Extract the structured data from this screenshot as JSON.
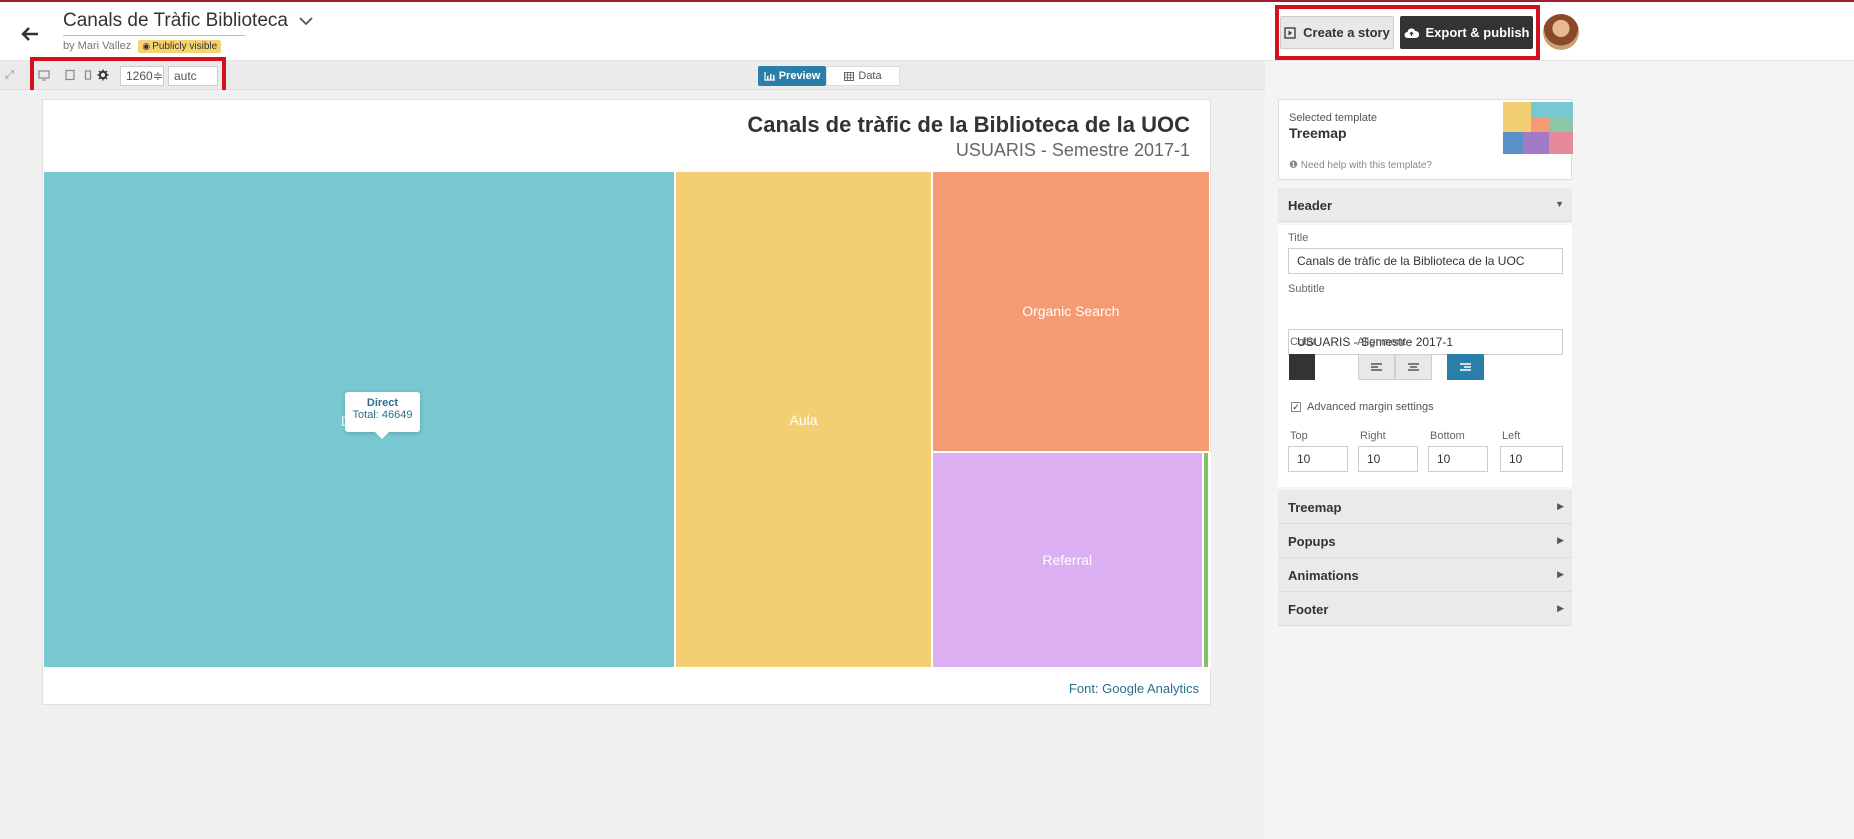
{
  "header": {
    "doc_title": "Canals de Tràfic Biblioteca",
    "byline": "by Mari Vallez",
    "visibility_badge": "Publicly visible",
    "create_story_label": "Create a story",
    "export_label": "Export & publish"
  },
  "toolbar": {
    "width_value": "1260",
    "height_value": "autc",
    "preview_label": "Preview",
    "data_label": "Data"
  },
  "chart": {
    "title": "Canals de tràfic de la Biblioteca de la UOC",
    "subtitle": "USUARIS - Semestre 2017-1",
    "footer": "Font: Google Analytics",
    "tooltip_name": "Direct",
    "tooltip_value": "Total: 46649"
  },
  "chart_data": {
    "type": "treemap",
    "title": "Canals de tràfic de la Biblioteca de la UOC",
    "subtitle": "USUARIS - Semestre 2017-1",
    "nodes": [
      {
        "name": "Direct",
        "value": 46649,
        "color": "#77c8d0"
      },
      {
        "name": "Aula",
        "value": 18900,
        "color": "#f4ce73"
      },
      {
        "name": "Organic Search",
        "value": 11600,
        "color": "#f59b74"
      },
      {
        "name": "Referral",
        "value": 8700,
        "color": "#dcaef2"
      },
      {
        "name": "",
        "value": 210,
        "color": "#7cc466"
      },
      {
        "name": "",
        "value": 20,
        "color": "#77c8d0"
      }
    ]
  },
  "panel": {
    "selected_template_label": "Selected template",
    "template_name": "Treemap",
    "help_text": "Need help with this template?",
    "sections": {
      "header": "Header",
      "treemap": "Treemap",
      "popups": "Popups",
      "animations": "Animations",
      "footer": "Footer"
    },
    "title_label": "Title",
    "title_value": "Canals de tràfic de la Biblioteca de la UOC",
    "subtitle_label": "Subtitle",
    "subtitle_value": "USUARIS - Semestre 2017-1",
    "color_label": "Color",
    "alignment_label": "Alignment",
    "alignment_selected": "right",
    "advanced_margin_label": "Advanced margin settings",
    "margins": {
      "top_label": "Top",
      "top_value": "10",
      "right_label": "Right",
      "right_value": "10",
      "bottom_label": "Bottom",
      "bottom_value": "10",
      "left_label": "Left",
      "left_value": "10"
    }
  },
  "colors": {
    "accent": "#2a7fa8",
    "highlight_box": "#d4101e",
    "dark_button": "#333333"
  }
}
